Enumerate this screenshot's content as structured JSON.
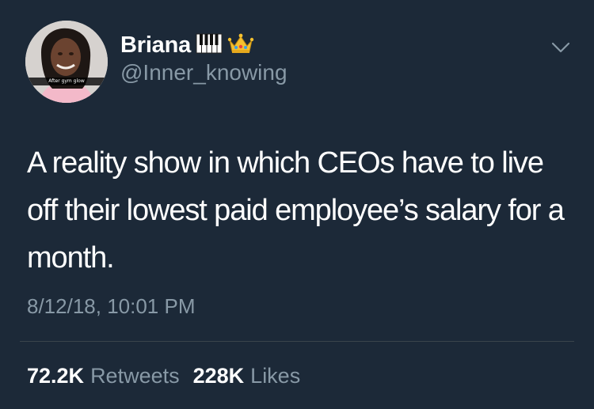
{
  "author": {
    "display_name": "Briana",
    "handle": "@Inner_knowing",
    "avatar_caption": "After gym glow",
    "name_emoji": [
      "piano-keys-emoji",
      "crown-emoji"
    ]
  },
  "tweet": {
    "text": "A reality show in which CEOs have to live off their lowest paid employee’s salary for a month.",
    "timestamp": "8/12/18, 10:01 PM"
  },
  "stats": {
    "retweets_count": "72.2K",
    "retweets_label": "Retweets",
    "likes_count": "228K",
    "likes_label": "Likes"
  },
  "colors": {
    "background": "#1c2938",
    "primary_text": "#ffffff",
    "secondary_text": "#8899a6",
    "divider": "#3a444c"
  },
  "icons": {
    "menu": "chevron-down-icon"
  }
}
